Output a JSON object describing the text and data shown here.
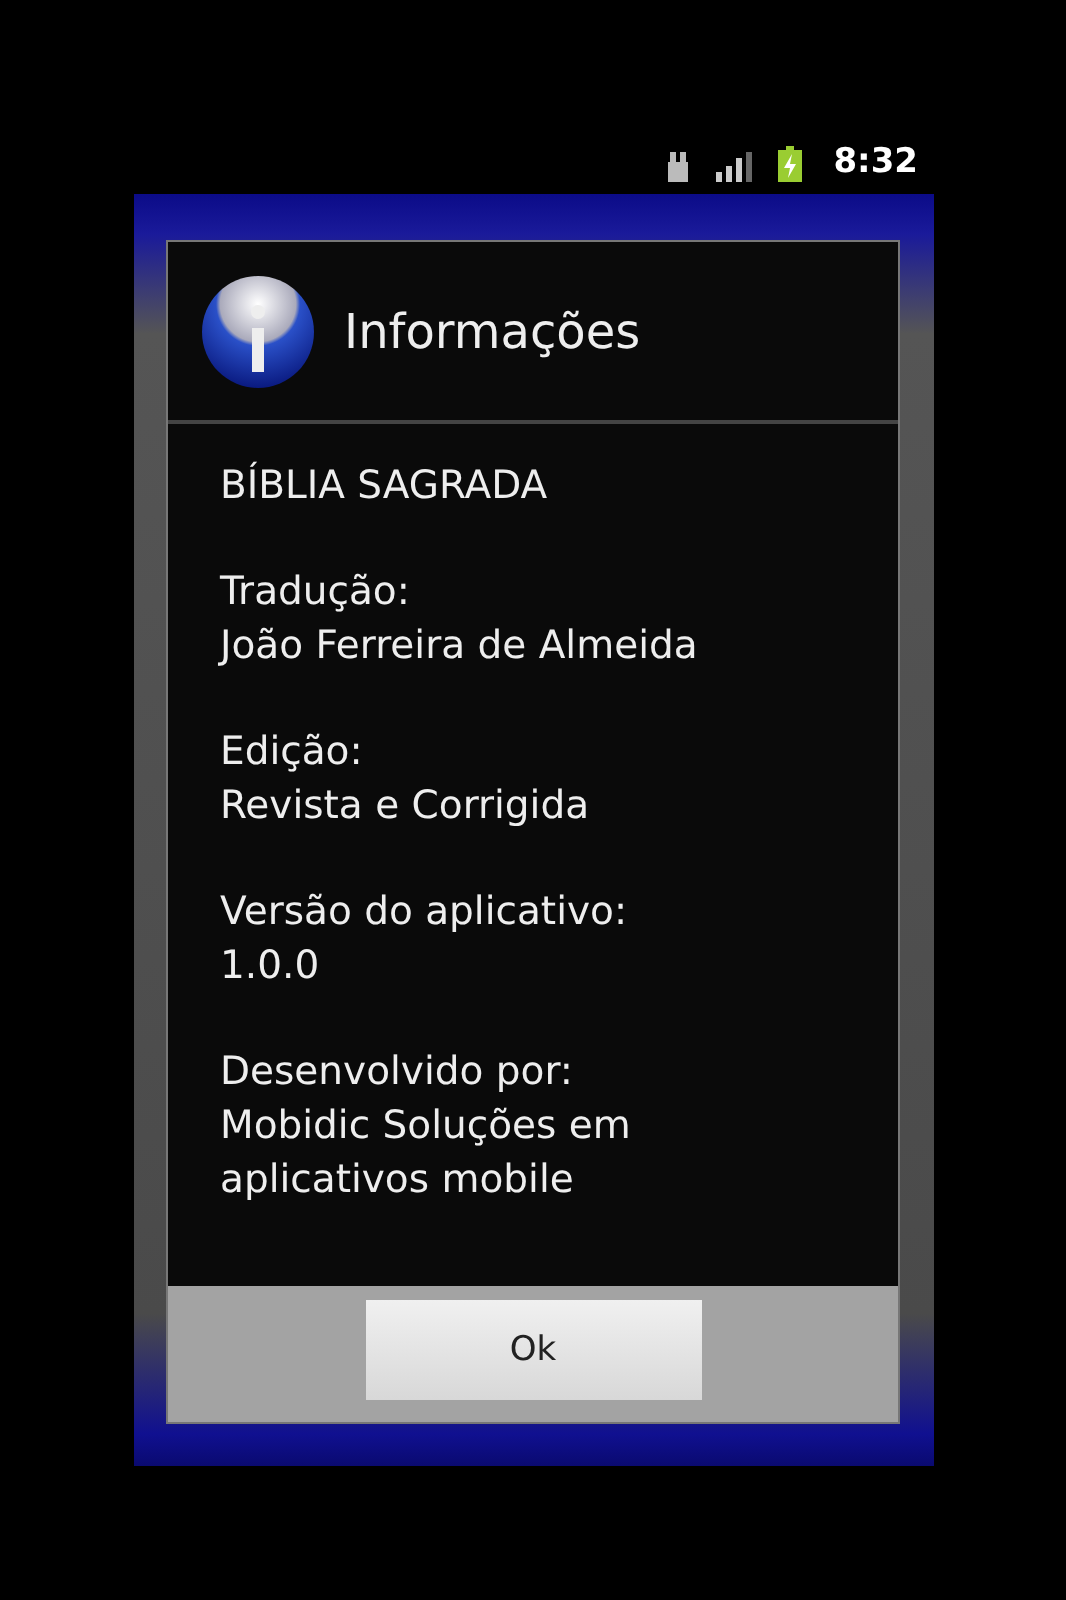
{
  "status_bar": {
    "time": "8:32"
  },
  "dialog": {
    "title": "Informações",
    "items": [
      {
        "kind": "heading",
        "text": "BÍBLIA SAGRADA"
      },
      {
        "kind": "field",
        "label": "Tradução:",
        "value": "João Ferreira de Almeida"
      },
      {
        "kind": "field",
        "label": "Edição:",
        "value": "Revista e Corrigida"
      },
      {
        "kind": "field",
        "label": "Versão do aplicativo:",
        "value": "1.0.0"
      },
      {
        "kind": "field",
        "label": "Desenvolvido por:",
        "value": "Mobidic Soluções em aplicativos mobile"
      }
    ],
    "buttons": [
      "Ok"
    ]
  }
}
